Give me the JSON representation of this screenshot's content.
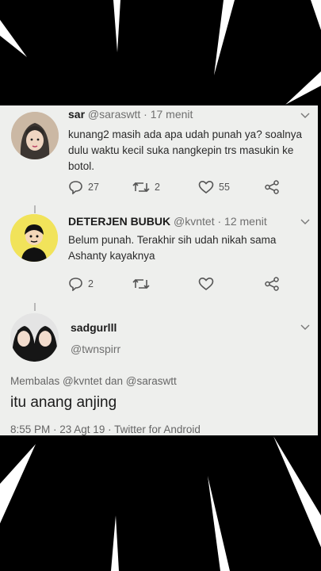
{
  "tweets": [
    {
      "name": "sar",
      "handle": "@saraswtt",
      "time": "· 17 menit",
      "text": "kunang2 masih ada apa udah punah ya? soalnya dulu waktu kecil suka nangkepin trs masukin ke botol.",
      "replies": "27",
      "retweets": "2",
      "likes": "55"
    },
    {
      "name": "DETERJEN BUBUK",
      "handle": "@kvntet",
      "time": "· 12 menit",
      "text": "Belum punah. Terakhir sih udah nikah sama Ashanty kayaknya",
      "replies": "2",
      "retweets": "",
      "likes": ""
    }
  ],
  "main_tweet": {
    "name": "sadgurlll",
    "handle": "@twnspirr",
    "reply_to": "Membalas @kvntet dan @saraswtt",
    "text": "itu anang anjing",
    "timestamp": "8:55 PM · 23 Agt 19 · Twitter for Android"
  },
  "colors": {
    "background": "#000000",
    "card": "#eeefed",
    "meta_text": "#6f6f6f",
    "icon": "#555555"
  }
}
